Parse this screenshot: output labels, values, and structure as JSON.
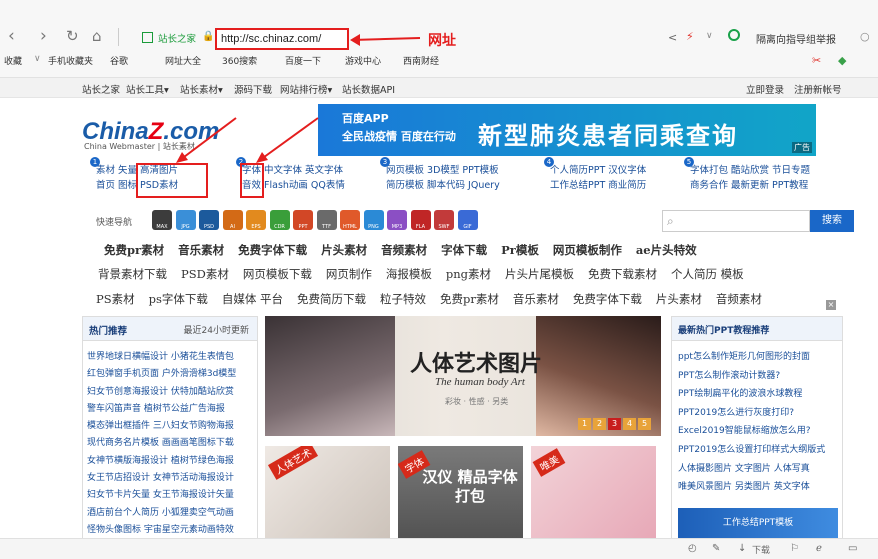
{
  "browser": {
    "url": "http://sc.chinaz.com/",
    "site_tab": "站长之家",
    "url_annotation": "网址",
    "right_text": "隔离向指导组举报",
    "bookmarks": [
      "收藏",
      "手机收藏夹",
      "谷歌",
      "网址大全",
      "360搜索",
      "百度一下",
      "游戏中心",
      "西南财经"
    ]
  },
  "sitebar": {
    "items": [
      "站长之家",
      "站长工具▾",
      "站长素材▾",
      "源码下载",
      "网站排行榜▾",
      "站长数据API"
    ],
    "login": "立即登录",
    "register": "注册新帐号"
  },
  "logo": {
    "main_left": "China",
    "main_z": "Z",
    "main_right": ".com",
    "sub": "China Webmaster | 站长素材"
  },
  "banner": {
    "app": "百度APP",
    "line2": "全民战疫情 百度在行动",
    "headline": "新型肺炎患者同乘查询",
    "ad": "广告"
  },
  "categories": [
    {
      "num": "1",
      "lines": [
        "素材  矢量  高清图片",
        "首页  图标  PSD素材"
      ]
    },
    {
      "num": "2",
      "lines": [
        "字体  中文字体  英文字体",
        "音效  Flash动画  QQ表情"
      ]
    },
    {
      "num": "3",
      "lines": [
        "网页模板  3D模型  PPT模板",
        "简历模板  脚本代码  JQuery"
      ]
    },
    {
      "num": "4",
      "lines": [
        "个人简历PPT  汉仪字体",
        "工作总结PPT  商业简历"
      ]
    },
    {
      "num": "5",
      "lines": [
        "字体打包  酷站欣赏  节日专题",
        "商务合作  最新更新  PPT教程"
      ]
    }
  ],
  "quicknav": {
    "label": "快速导航",
    "icons": [
      {
        "label": "MAX",
        "color": "#3c3c3c"
      },
      {
        "label": "JPG",
        "color": "#3a8fd8"
      },
      {
        "label": "PSD",
        "color": "#1c5a9c"
      },
      {
        "label": "AI",
        "color": "#d36a16"
      },
      {
        "label": "EPS",
        "color": "#e28a1e"
      },
      {
        "label": "CDR",
        "color": "#3a9e3a"
      },
      {
        "label": "PPT",
        "color": "#d24726"
      },
      {
        "label": "TTF",
        "color": "#6a6a6a"
      },
      {
        "label": "HTML",
        "color": "#e0592a"
      },
      {
        "label": "PNG",
        "color": "#2b8ad6"
      },
      {
        "label": "MP3",
        "color": "#8b4fc4"
      },
      {
        "label": "FLA",
        "color": "#c02626"
      },
      {
        "label": "SWF",
        "color": "#c23a3a"
      },
      {
        "label": "GIF",
        "color": "#3a6ad6"
      }
    ],
    "search_button": "搜索"
  },
  "tags": [
    [
      "免费pr素材",
      "音乐素材",
      "免费字体下载",
      "片头素材",
      "音频素材",
      "字体下载",
      "Pr模板",
      "网页模板制作",
      "ae片头特效"
    ],
    [
      "背景素材下载",
      "PSD素材",
      "网页模板下载",
      "网页制作",
      "海报模板",
      "png素材",
      "片头片尾模板",
      "免费下载素材",
      "个人简历 模板"
    ],
    [
      "PS素材",
      "ps字体下载",
      "自媒体 平台",
      "免费简历下载",
      "粒子特效",
      "免费pr素材",
      "音乐素材",
      "免费字体下载",
      "片头素材",
      "音频素材"
    ]
  ],
  "left_panel": {
    "title": "热门推荐",
    "subtitle": "最近24小时更新",
    "items": [
      "世界地球日横幅设计  小猪花生表情包",
      "红包弹窗手机页面  户外滑滑梯3d模型",
      "妇女节创意海报设计  伏特加酷站欣赏",
      "警车闪笛声音  植树节公益广告海报",
      "模态弹出框插件  三八妇女节购物海报",
      "现代商务名片模板  画画画笔图标下载",
      "女神节横版海报设计  植树节绿色海报",
      "女王节店招设计  女神节活动海报设计",
      "妇女节卡片矢量  女王节海报设计矢量",
      "酒店前台个人简历  小狐狸卖空气动画",
      "怪物头像图标  宇宙星空元素动画特效"
    ]
  },
  "feature": {
    "title": "人体艺术图片",
    "subtitle": "The human body Art",
    "tagline": "彩妆 · 性感 · 另类",
    "pages": [
      "1",
      "2",
      "3",
      "4",
      "5"
    ]
  },
  "thumbs": [
    {
      "label": "人体艺术"
    },
    {
      "label": "汉仪 精品字体 打包",
      "tag": "字体"
    },
    {
      "label": "唯美"
    }
  ],
  "right_panel": {
    "title": "最新热门PPT教程推荐",
    "items": [
      "ppt怎么制作矩形几何图形的封面",
      "PPT怎么制作滚动计数器?",
      "PPT绘制扁平化的波浪水球教程",
      "PPT2019怎么进行灰度打印?",
      "Excel2019智能鼠标缩放怎么用?",
      "PPT2019怎么设置打印样式大纲版式",
      "人体摄影图片  文字图片  人体写真",
      "唯美风景图片  另类图片  英文字体"
    ],
    "promo": "工作总结PPT模板"
  },
  "statusbar": {
    "download": "下载"
  }
}
